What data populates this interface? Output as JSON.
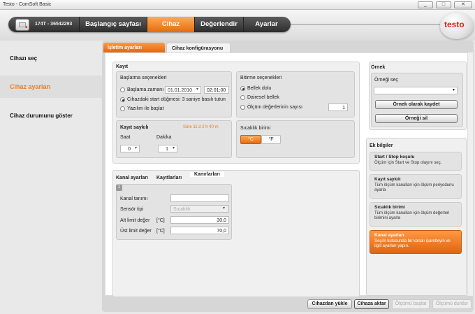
{
  "window": {
    "title": "Testo - ComSoft Basic",
    "controls": [
      "_",
      "□",
      "✕"
    ]
  },
  "device": {
    "id": "174T - 36542293"
  },
  "nav": {
    "tabs": [
      "Başlangıç sayfası",
      "Cihaz",
      "Değerlendir",
      "Ayarlar"
    ],
    "active": "Cihaz"
  },
  "logo": {
    "text": "testo"
  },
  "sidebar": {
    "items": [
      "Cihazı seç",
      "Cihaz ayarları",
      "Cihaz durumunu göster"
    ],
    "active": "Cihaz ayarları"
  },
  "tabs": [
    "İşletim ayarları",
    "Cihaz konfigürasyonu"
  ],
  "kayit": {
    "title": "Kayıt",
    "baslatma": {
      "title": "Başlatma seçenekleri",
      "opt1": "Başlama zamanı",
      "date": "01.01.2010",
      "time": "02:01:00",
      "opt2": "Cihazdaki start düğmesi: 3 saniye basılı tutun",
      "opt3": "Yazılım ile başlat"
    },
    "bitirme": {
      "title": "Bitirme seçenekleri",
      "opt1": "Bellek dolu",
      "opt2": "Dairesel bellek",
      "opt3": "Ölçüm değerlerinin sayısı",
      "count": "1"
    },
    "saykil": {
      "title": "Kayıt saykılı",
      "duration": "Süre 11 d 2 h 40 m",
      "saat_label": "Saat",
      "dakika_label": "Dakika",
      "saat": "0",
      "dakika": "1"
    },
    "birim": {
      "title": "Sıcaklık birimi",
      "c": "°C",
      "f": "°F",
      "selected": "°C"
    }
  },
  "kanal": {
    "tab_title": "Kanal ayarları",
    "tab_title2": "Kayıtlarları",
    "ghost_title": "Kanırlarları",
    "channel": "1",
    "tanim_label": "Kanal tanımı",
    "tanim": "",
    "sensor_label": "Sensör tipi",
    "sensor": "Sıcaklık",
    "alt_label": "Alt limit değer",
    "alt_unit": "[°C]",
    "alt": "30,0",
    "ust_label": "Üst limit değer",
    "ust_unit": "[°C]",
    "ust": "70,0"
  },
  "ornek": {
    "title": "Örnek",
    "sec_label": "Örneği seç",
    "save": "Örnek olarak kaydet",
    "delete": "Örneği sil"
  },
  "ekbilgi": {
    "title": "Ek bilgiler",
    "items": [
      {
        "title": "Start / Stop koşulu",
        "text": "Ölçüm için Start ve Stop olayını seç."
      },
      {
        "title": "Kayıt saykılı",
        "text": "Tüm ölçüm kanalları için ölçüm periyodunu ayarla"
      },
      {
        "title": "Sıcaklık birimi",
        "text": "Tüm ölçüm kanalları için ölçüm değerleri birimini ayarla"
      },
      {
        "title": "Kanal ayarları",
        "text": "Seçim kutusunda bir kanalı işaretleyin ve ilgili ayarları yapın."
      }
    ],
    "active": 3
  },
  "bottom": {
    "load": "Cihazdan yükle",
    "transfer": "Cihaza aktar",
    "start": "Ölçümü başlat",
    "stop": "Ölçümü durdur"
  },
  "colors": {
    "accent": "#ee7a1a",
    "nav": "#3a3a3a"
  }
}
